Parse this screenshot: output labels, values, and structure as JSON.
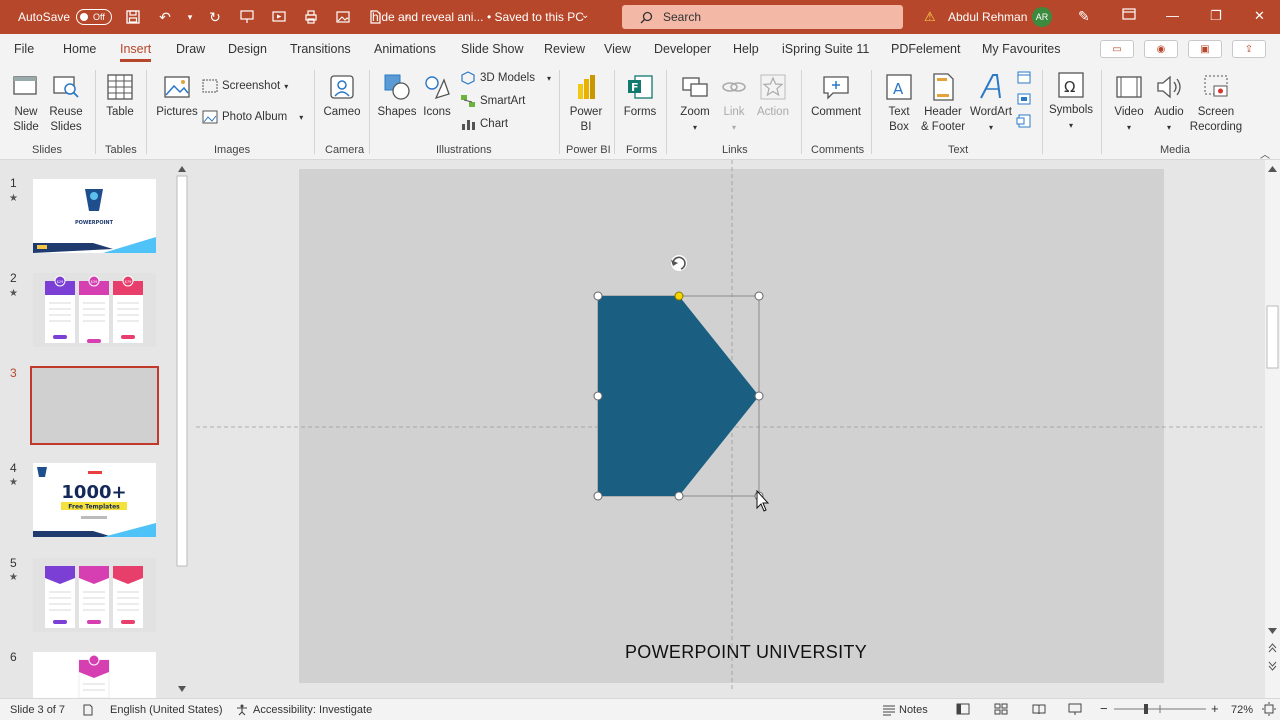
{
  "titlebar": {
    "autosave_label": "AutoSave",
    "autosave_state": "Off",
    "doc_title": "hide and reveal ani...",
    "saved_status": "• Saved to this PC",
    "search_placeholder": "Search",
    "user_name": "Abdul Rehman",
    "user_initials": "AR"
  },
  "tabs": [
    {
      "label": "File"
    },
    {
      "label": "Home"
    },
    {
      "label": "Insert"
    },
    {
      "label": "Draw"
    },
    {
      "label": "Design"
    },
    {
      "label": "Transitions"
    },
    {
      "label": "Animations"
    },
    {
      "label": "Slide Show"
    },
    {
      "label": "Review"
    },
    {
      "label": "View"
    },
    {
      "label": "Developer"
    },
    {
      "label": "Help"
    },
    {
      "label": "iSpring Suite 11"
    },
    {
      "label": "PDFelement"
    },
    {
      "label": "My Favourites"
    }
  ],
  "ribbon": {
    "new_slide": "New\nSlide",
    "reuse_slides": "Reuse\nSlides",
    "table": "Table",
    "pictures": "Pictures",
    "screenshot": "Screenshot",
    "photo_album": "Photo Album",
    "cameo": "Cameo",
    "shapes": "Shapes",
    "icons": "Icons",
    "models_3d": "3D Models",
    "smartart": "SmartArt",
    "chart": "Chart",
    "power_bi": "Power\nBI",
    "forms": "Forms",
    "zoom": "Zoom",
    "link": "Link",
    "action": "Action",
    "comment": "Comment",
    "text_box": "Text\nBox",
    "header_footer": "Header\n& Footer",
    "wordart": "WordArt",
    "symbols": "Symbols",
    "video": "Video",
    "audio": "Audio",
    "screen_recording": "Screen\nRecording",
    "groups": {
      "slides": "Slides",
      "tables": "Tables",
      "images": "Images",
      "camera": "Camera",
      "illustrations": "Illustrations",
      "power_bi": "Power BI",
      "forms": "Forms",
      "links": "Links",
      "comments": "Comments",
      "text": "Text",
      "media": "Media"
    }
  },
  "thumbnails": [
    {
      "number": "1",
      "star": "★"
    },
    {
      "number": "2",
      "star": "★"
    },
    {
      "number": "3",
      "star": ""
    },
    {
      "number": "4",
      "star": "★"
    },
    {
      "number": "5",
      "star": "★"
    },
    {
      "number": "6",
      "star": ""
    }
  ],
  "thumb_text": {
    "t1_title": "POWERPOINT",
    "t4_big": "1000+",
    "t4_banner": "Free Templates",
    "price_a": "$29",
    "price_b": "$39",
    "price_c": "$79"
  },
  "slide": {
    "footer_text": "POWERPOINT UNIVERSITY",
    "shape_color": "#1a5f82"
  },
  "statusbar": {
    "slide_info": "Slide 3 of 7",
    "language": "English (United States)",
    "accessibility": "Accessibility: Investigate",
    "notes": "Notes",
    "zoom": "72%"
  },
  "colors": {
    "accent": "#b7472a",
    "selection_border": "#c0392b"
  }
}
